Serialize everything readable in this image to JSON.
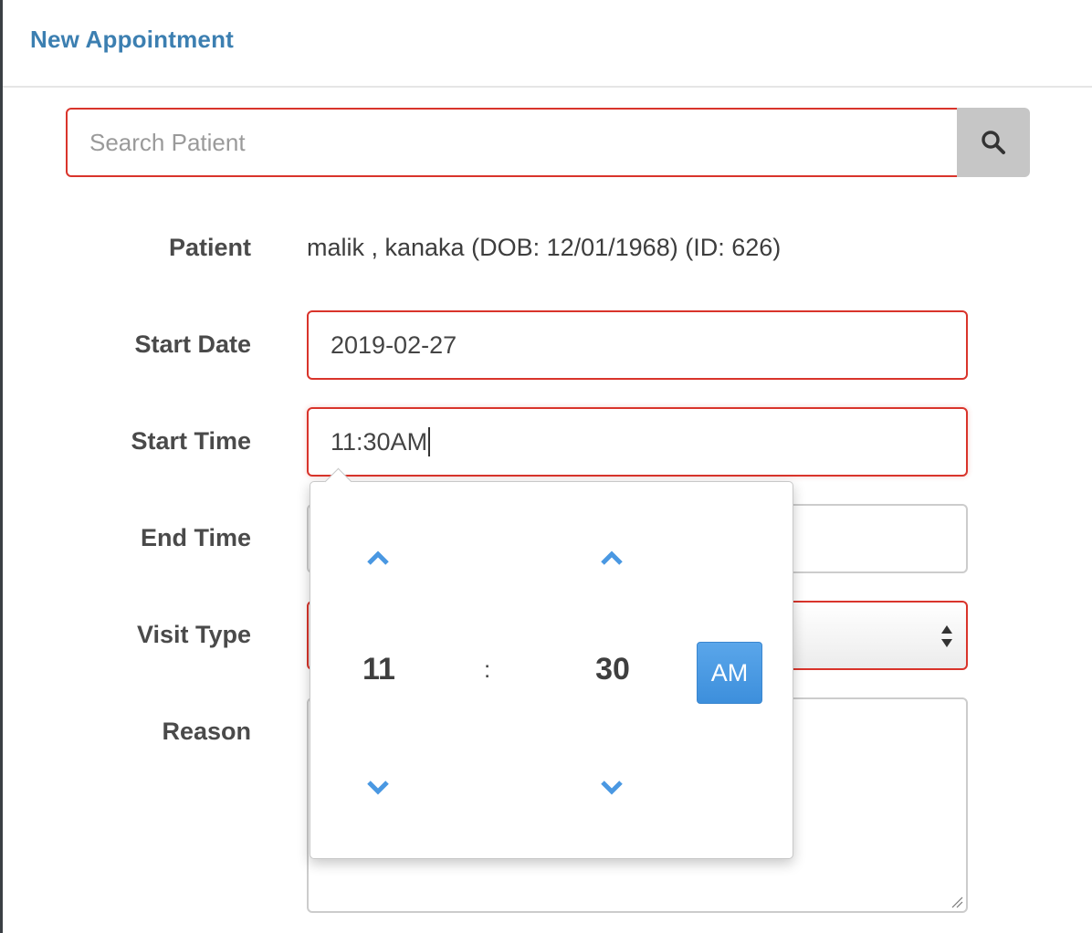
{
  "modal": {
    "title": "New Appointment"
  },
  "search": {
    "placeholder": "Search Patient",
    "value": "",
    "button_icon": "search-icon"
  },
  "form": {
    "patient_label": "Patient",
    "patient_value": "malik , kanaka (DOB: 12/01/1968) (ID: 626)",
    "start_date_label": "Start Date",
    "start_date_value": "2019-02-27",
    "start_time_label": "Start Time",
    "start_time_value": "11:30AM",
    "end_time_label": "End Time",
    "end_time_value": "",
    "visit_type_label": "Visit Type",
    "visit_type_value": "",
    "reason_label": "Reason",
    "reason_value": ""
  },
  "time_picker": {
    "hour": "11",
    "separator": ":",
    "minute": "30",
    "meridian": "AM",
    "icons": [
      "chevron-up-icon",
      "chevron-down-icon"
    ]
  },
  "colors": {
    "title": "#3c7fb1",
    "error_border": "#d9342b",
    "accent_button": "#4a98e2",
    "chevron": "#4a98e2",
    "search_button_bg": "#c6c6c6"
  }
}
